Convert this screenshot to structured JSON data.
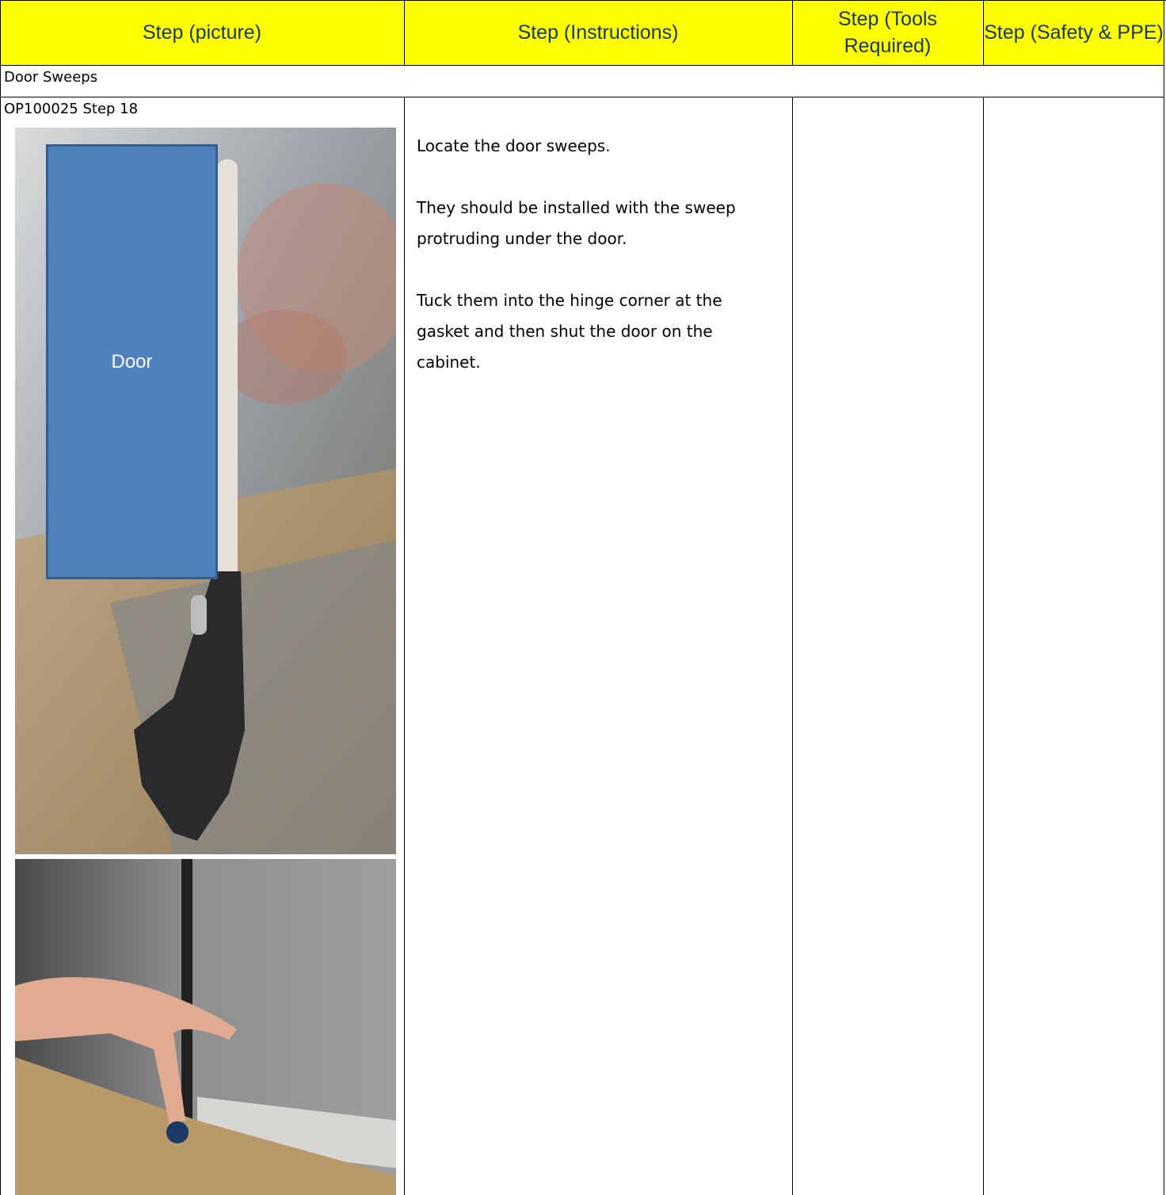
{
  "header": {
    "col_picture": "Step (picture)",
    "col_instructions": "Step (Instructions)",
    "col_tools": "Step (Tools Required)",
    "col_safety": "Step (Safety & PPE)"
  },
  "section": {
    "title": "Door Sweeps"
  },
  "step": {
    "label": "OP100025 Step 18",
    "callout_label": "Door",
    "instructions": [
      "Locate the door sweeps.",
      "They should be installed with the sweep protruding under the door.",
      "Tuck them into the hinge corner at the gasket and then shut the door on the cabinet."
    ],
    "tools": "",
    "safety": ""
  },
  "colors": {
    "header_bg": "#ffff00",
    "header_text": "#17375e",
    "callout_fill": "#4f81bd",
    "callout_border": "#385d8a"
  }
}
